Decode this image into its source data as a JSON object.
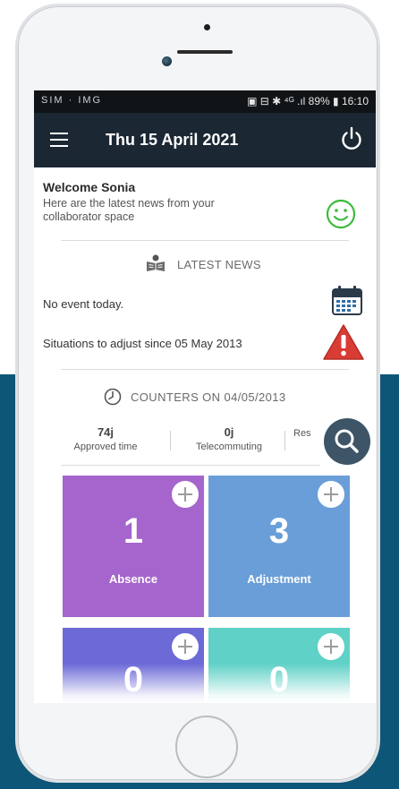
{
  "status_bar": {
    "left_icons": "SIM · IMG",
    "right_text": "▣ ⊟ ✱ ⁴ᴳ .ıl 89% ▮ 16:10"
  },
  "app_bar": {
    "date": "Thu 15 April 2021",
    "menu_icon": "hamburger-menu-icon",
    "power_icon": "power-icon"
  },
  "welcome": {
    "title": "Welcome Sonia",
    "subtitle": "Here are the latest news from your collaborator space",
    "icon": "smiley-icon",
    "icon_color": "#3dbb3d"
  },
  "latest_news": {
    "label": "LATEST NEWS",
    "icon": "news-reader-icon"
  },
  "events": {
    "no_event": "No event today.",
    "calendar_icon": "calendar-icon",
    "situations": "Situations to adjust since 05 May 2013",
    "warning_icon": "warning-icon",
    "warning_color": "#d93b35"
  },
  "counters": {
    "title": "COUNTERS ON 04/05/2013",
    "items": [
      {
        "value": "74j",
        "label": "Approved time"
      },
      {
        "value": "0j",
        "label": "Telecommuting"
      },
      {
        "value": "",
        "label": "Res"
      }
    ],
    "search_icon": "search-icon"
  },
  "tiles": [
    {
      "count": "1",
      "name": "Absence",
      "color": "#a565cc"
    },
    {
      "count": "3",
      "name": "Adjustment",
      "color": "#6a9ed8"
    },
    {
      "count": "0",
      "name": "",
      "color": "#6c6ad6"
    },
    {
      "count": "0",
      "name": "",
      "color": "#5fd1c6"
    }
  ]
}
